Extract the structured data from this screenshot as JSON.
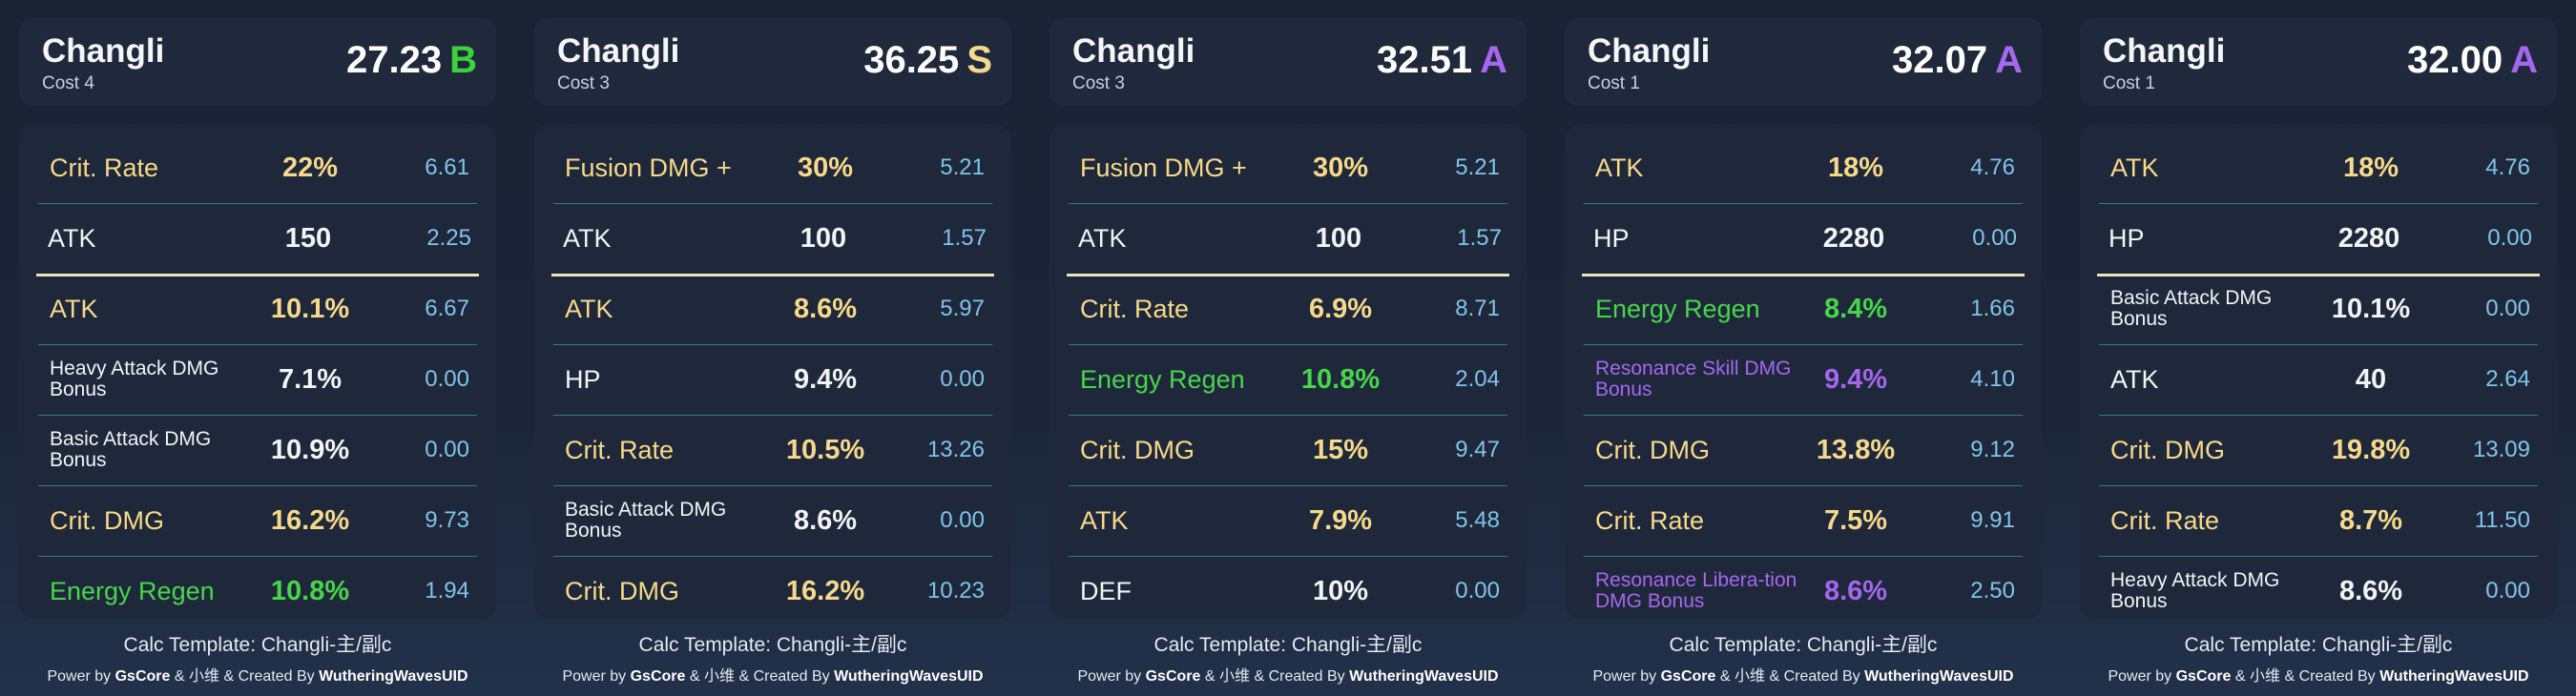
{
  "panels": [
    {
      "name": "Changli",
      "cost": "Cost 4",
      "score": "27.23",
      "grade": "B",
      "grade_color": "#3bd13b",
      "rows": [
        {
          "label": "Crit. Rate",
          "value": "22%",
          "score": "6.61",
          "color": "gold"
        },
        {
          "label": "ATK",
          "value": "150",
          "score": "2.25",
          "color": "white"
        },
        {
          "label": "ATK",
          "value": "10.1%",
          "score": "6.67",
          "color": "gold"
        },
        {
          "label": "Heavy Attack DMG Bonus",
          "value": "7.1%",
          "score": "0.00",
          "color": "white",
          "small": true
        },
        {
          "label": "Basic Attack DMG Bonus",
          "value": "10.9%",
          "score": "0.00",
          "color": "white",
          "small": true
        },
        {
          "label": "Crit. DMG",
          "value": "16.2%",
          "score": "9.73",
          "color": "gold"
        },
        {
          "label": "Energy Regen",
          "value": "10.8%",
          "score": "1.94",
          "color": "green"
        }
      ],
      "template": "Calc Template: Changli-主/副c"
    },
    {
      "name": "Changli",
      "cost": "Cost 3",
      "score": "36.25",
      "grade": "S",
      "grade_color": "#f6d98a",
      "rows": [
        {
          "label": "Fusion DMG +",
          "value": "30%",
          "score": "5.21",
          "color": "gold"
        },
        {
          "label": "ATK",
          "value": "100",
          "score": "1.57",
          "color": "white"
        },
        {
          "label": "ATK",
          "value": "8.6%",
          "score": "5.97",
          "color": "gold"
        },
        {
          "label": "HP",
          "value": "9.4%",
          "score": "0.00",
          "color": "white"
        },
        {
          "label": "Crit. Rate",
          "value": "10.5%",
          "score": "13.26",
          "color": "gold"
        },
        {
          "label": "Basic Attack DMG Bonus",
          "value": "8.6%",
          "score": "0.00",
          "color": "white",
          "small": true
        },
        {
          "label": "Crit. DMG",
          "value": "16.2%",
          "score": "10.23",
          "color": "gold"
        }
      ],
      "template": "Calc Template: Changli-主/副c"
    },
    {
      "name": "Changli",
      "cost": "Cost 3",
      "score": "32.51",
      "grade": "A",
      "grade_color": "#a567f0",
      "rows": [
        {
          "label": "Fusion DMG +",
          "value": "30%",
          "score": "5.21",
          "color": "gold"
        },
        {
          "label": "ATK",
          "value": "100",
          "score": "1.57",
          "color": "white"
        },
        {
          "label": "Crit. Rate",
          "value": "6.9%",
          "score": "8.71",
          "color": "gold"
        },
        {
          "label": "Energy Regen",
          "value": "10.8%",
          "score": "2.04",
          "color": "green"
        },
        {
          "label": "Crit. DMG",
          "value": "15%",
          "score": "9.47",
          "color": "gold"
        },
        {
          "label": "ATK",
          "value": "7.9%",
          "score": "5.48",
          "color": "gold"
        },
        {
          "label": "DEF",
          "value": "10%",
          "score": "0.00",
          "color": "white"
        }
      ],
      "template": "Calc Template: Changli-主/副c"
    },
    {
      "name": "Changli",
      "cost": "Cost 1",
      "score": "32.07",
      "grade": "A",
      "grade_color": "#a567f0",
      "rows": [
        {
          "label": "ATK",
          "value": "18%",
          "score": "4.76",
          "color": "gold"
        },
        {
          "label": "HP",
          "value": "2280",
          "score": "0.00",
          "color": "white"
        },
        {
          "label": "Energy Regen",
          "value": "8.4%",
          "score": "1.66",
          "color": "green"
        },
        {
          "label": "Resonance Skill DMG Bonus",
          "value": "9.4%",
          "score": "4.10",
          "color": "purple",
          "small": true
        },
        {
          "label": "Crit. DMG",
          "value": "13.8%",
          "score": "9.12",
          "color": "gold"
        },
        {
          "label": "Crit. Rate",
          "value": "7.5%",
          "score": "9.91",
          "color": "gold"
        },
        {
          "label": "Resonance Libera-tion DMG Bonus",
          "value": "8.6%",
          "score": "2.50",
          "color": "purple",
          "small": true
        }
      ],
      "template": "Calc Template: Changli-主/副c"
    },
    {
      "name": "Changli",
      "cost": "Cost 1",
      "score": "32.00",
      "grade": "A",
      "grade_color": "#a567f0",
      "rows": [
        {
          "label": "ATK",
          "value": "18%",
          "score": "4.76",
          "color": "gold"
        },
        {
          "label": "HP",
          "value": "2280",
          "score": "0.00",
          "color": "white"
        },
        {
          "label": "Basic Attack DMG Bonus",
          "value": "10.1%",
          "score": "0.00",
          "color": "white",
          "small": true
        },
        {
          "label": "ATK",
          "value": "40",
          "score": "2.64",
          "color": "white"
        },
        {
          "label": "Crit. DMG",
          "value": "19.8%",
          "score": "13.09",
          "color": "gold"
        },
        {
          "label": "Crit. Rate",
          "value": "8.7%",
          "score": "11.50",
          "color": "gold"
        },
        {
          "label": "Heavy Attack DMG Bonus",
          "value": "8.6%",
          "score": "0.00",
          "color": "white",
          "small": true
        }
      ],
      "template": "Calc Template: Changli-主/副c"
    }
  ],
  "footer": {
    "power_by": "Power by",
    "gscore": "GsCore",
    "amp1": "&",
    "xiaowei": "小维",
    "amp2": "& Created By",
    "uid": "WutheringWavesUID"
  },
  "colors": {
    "gold": "#f6d98a",
    "white": "#f1f3f7",
    "green": "#47d64b",
    "purple": "#a567f0",
    "score_blue": "#7fc4ea"
  }
}
